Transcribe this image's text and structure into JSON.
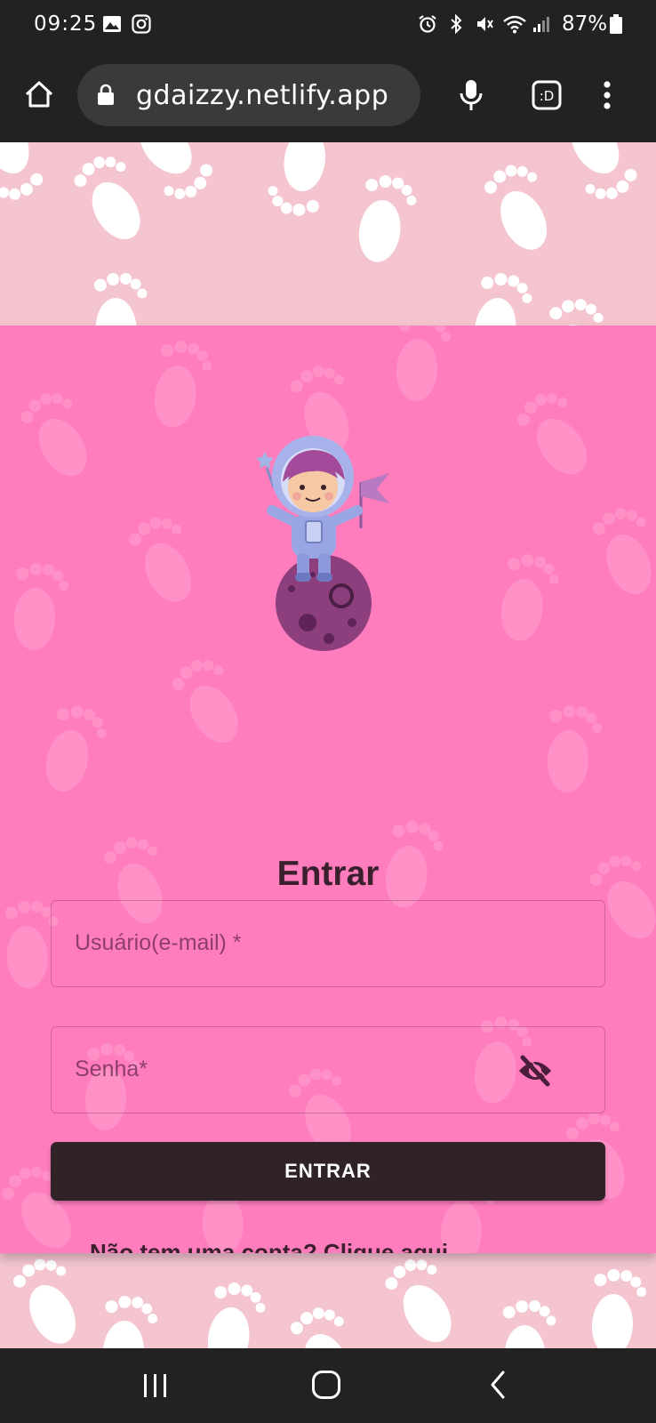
{
  "status_bar": {
    "time": "09:25",
    "battery": "87%"
  },
  "browser": {
    "url": "gdaizzy.netlify.app"
  },
  "login": {
    "title": "Entrar",
    "username_placeholder": "Usuário(e-mail) *",
    "password_placeholder": "Senha*",
    "submit_label": "ENTRAR",
    "signup_link": "Não tem uma conta? Clique aqui"
  },
  "colors": {
    "card": "#ff7dbd",
    "background": "#f4c4cf",
    "button": "#2f2328",
    "text": "#3a1f2c"
  }
}
